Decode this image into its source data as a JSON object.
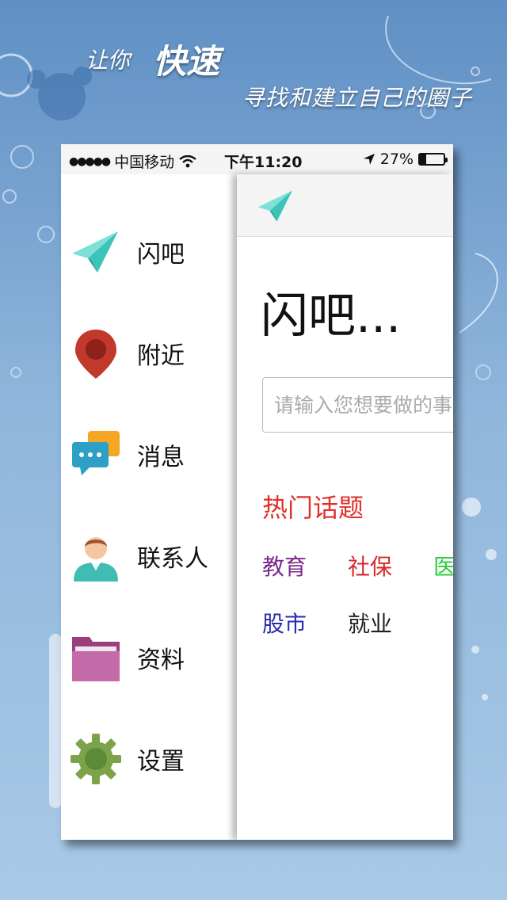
{
  "promo": {
    "line1_small": "让你",
    "line1_big": "快速",
    "line2": "寻找和建立自己的圈子"
  },
  "status_bar": {
    "signal": "●●●●●",
    "carrier": "中国移动",
    "time": "下午11:20",
    "battery_text": "27%",
    "battery_level": 0.27
  },
  "menu": {
    "items": [
      {
        "label": "闪吧",
        "icon": "paper-plane-icon"
      },
      {
        "label": "附近",
        "icon": "location-pin-icon"
      },
      {
        "label": "消息",
        "icon": "chat-bubbles-icon"
      },
      {
        "label": "联系人",
        "icon": "user-avatar-icon"
      },
      {
        "label": "资料",
        "icon": "folder-icon"
      },
      {
        "label": "设置",
        "icon": "gear-icon"
      }
    ]
  },
  "main": {
    "header_icon": "paper-plane-icon",
    "title": "闪吧...",
    "search_placeholder": "请输入您想要做的事",
    "hot_topics_title": "热门话题",
    "topics": [
      {
        "label": "教育",
        "color": "#7b2a8c"
      },
      {
        "label": "社保",
        "color": "#d8262d"
      },
      {
        "label": "医",
        "color": "#2ecc40"
      },
      {
        "label": "股市",
        "color": "#2a2ab0"
      },
      {
        "label": "就业",
        "color": "#222222"
      }
    ]
  },
  "colors": {
    "accent_red": "#e0302a",
    "plane_teal": "#3cc4b8"
  }
}
